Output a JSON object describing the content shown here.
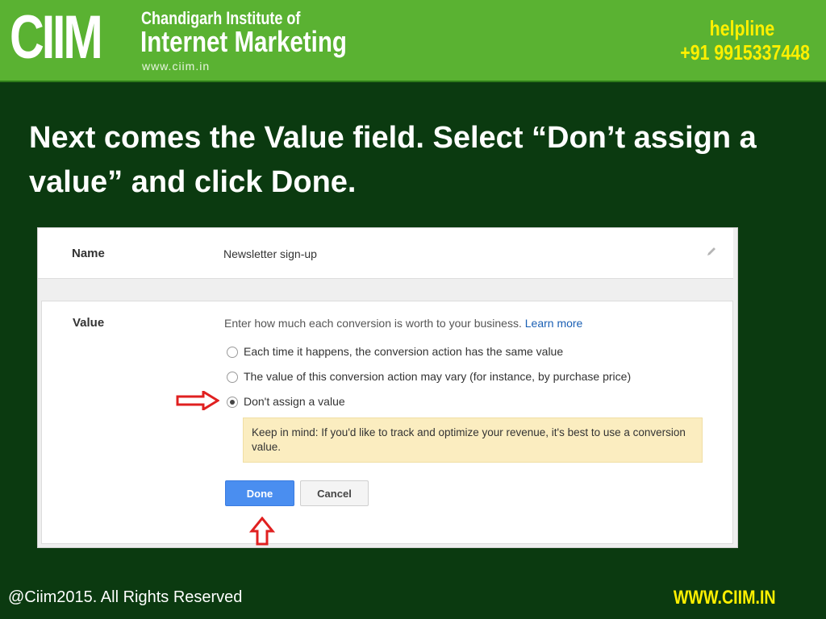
{
  "header": {
    "logo_text": "CIIM",
    "logo_line1": "Chandigarh Institute of",
    "logo_line2": "Internet Marketing",
    "logo_url": "www.ciim.in",
    "helpline_label": "helpline",
    "helpline_number": "+91 9915337448"
  },
  "instruction": "Next comes the Value field. Select “Don’t assign a value” and click Done.",
  "form": {
    "name_label": "Name",
    "name_value": "Newsletter sign-up",
    "value_label": "Value",
    "value_description": "Enter how much each conversion is worth to your business.",
    "learn_more": "Learn more",
    "options": [
      {
        "label": "Each time it happens, the conversion action has the same value",
        "selected": false
      },
      {
        "label": "The value of this conversion action may vary (for instance, by purchase price)",
        "selected": false
      },
      {
        "label": "Don't assign a value",
        "selected": true
      }
    ],
    "note": "Keep in mind: If you'd like to track and optimize your revenue, it's best to use a conversion value.",
    "done_label": "Done",
    "cancel_label": "Cancel"
  },
  "footer": {
    "copyright": "@Ciim2015. All Rights Reserved",
    "website": "WWW.CIIM.IN"
  },
  "colors": {
    "header_green": "#5ab232",
    "background_dark_green": "#0b3a10",
    "accent_yellow": "#fff000",
    "arrow_red": "#e02020",
    "done_blue": "#4a8ef0"
  },
  "icons": [
    "pencil-icon",
    "arrow-right-icon",
    "arrow-up-icon"
  ]
}
